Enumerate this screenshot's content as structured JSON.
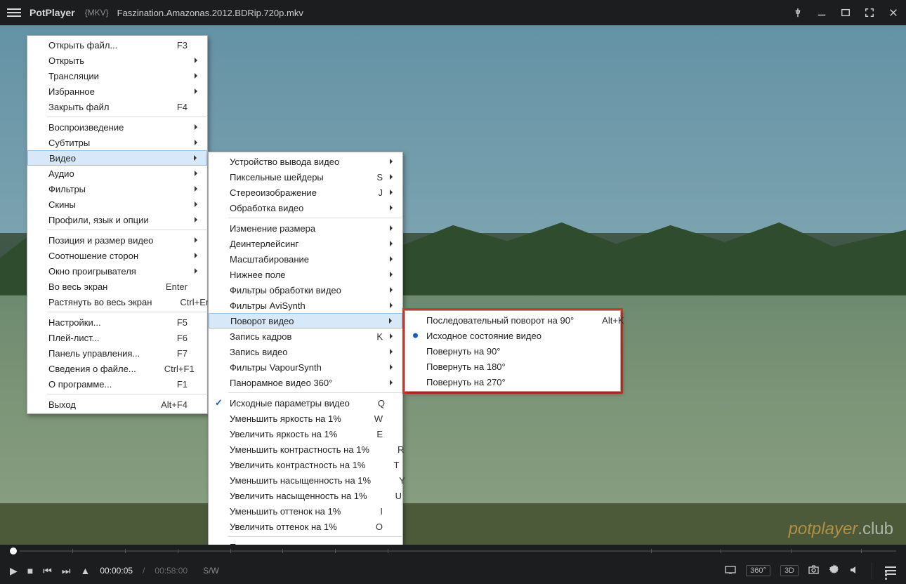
{
  "titlebar": {
    "app": "PotPlayer",
    "format": "{MKV}",
    "file": "Faszination.Amazonas.2012.BDRip.720p.mkv"
  },
  "watermark": {
    "main": "potplayer",
    "suffix": ".club"
  },
  "controls": {
    "current_time": "00:00:05",
    "total_time": "00:58:00",
    "hw": "S/W",
    "labels": {
      "360": "360°",
      "3d": "3D"
    }
  },
  "menu1": [
    {
      "t": "Открыть файл...",
      "sc": "F3"
    },
    {
      "t": "Открыть",
      "sub": true
    },
    {
      "t": "Трансляции",
      "sub": true
    },
    {
      "t": "Избранное",
      "sub": true
    },
    {
      "t": "Закрыть файл",
      "sc": "F4"
    },
    {
      "sep": true
    },
    {
      "t": "Воспроизведение",
      "sub": true
    },
    {
      "t": "Субтитры",
      "sub": true
    },
    {
      "t": "Видео",
      "sub": true,
      "hl": true
    },
    {
      "t": "Аудио",
      "sub": true
    },
    {
      "t": "Фильтры",
      "sub": true
    },
    {
      "t": "Скины",
      "sub": true
    },
    {
      "t": "Профили, язык и опции",
      "sub": true
    },
    {
      "sep": true
    },
    {
      "t": "Позиция и размер видео",
      "sub": true
    },
    {
      "t": "Соотношение сторон",
      "sub": true
    },
    {
      "t": "Окно проигрывателя",
      "sub": true
    },
    {
      "t": "Во весь экран",
      "sc": "Enter"
    },
    {
      "t": "Растянуть во весь экран",
      "sc": "Ctrl+Enter"
    },
    {
      "sep": true
    },
    {
      "t": "Настройки...",
      "sc": "F5"
    },
    {
      "t": "Плей-лист...",
      "sc": "F6"
    },
    {
      "t": "Панель управления...",
      "sc": "F7"
    },
    {
      "t": "Сведения о файле...",
      "sc": "Ctrl+F1"
    },
    {
      "t": "О программе...",
      "sc": "F1"
    },
    {
      "sep": true
    },
    {
      "t": "Выход",
      "sc": "Alt+F4"
    }
  ],
  "menu2": [
    {
      "t": "Устройство вывода видео",
      "sub": true
    },
    {
      "t": "Пиксельные шейдеры",
      "sc": "S",
      "sub": true
    },
    {
      "t": "Стереоизображение",
      "sc": "J",
      "sub": true
    },
    {
      "t": "Обработка видео",
      "sub": true
    },
    {
      "sep": true
    },
    {
      "t": "Изменение размера",
      "sub": true
    },
    {
      "t": "Деинтерлейсинг",
      "sub": true
    },
    {
      "t": "Масштабирование",
      "sub": true
    },
    {
      "t": "Нижнее поле",
      "sub": true
    },
    {
      "t": "Фильтры обработки видео",
      "sub": true
    },
    {
      "t": "Фильтры AviSynth",
      "sub": true
    },
    {
      "t": "Поворот видео",
      "sub": true,
      "hl": true
    },
    {
      "t": "Запись кадров",
      "sc": "K",
      "sub": true
    },
    {
      "t": "Запись видео",
      "sub": true
    },
    {
      "t": "Фильтры VapourSynth",
      "sub": true
    },
    {
      "t": "Панорамное видео 360°",
      "sub": true
    },
    {
      "sep": true
    },
    {
      "t": "Исходные параметры видео",
      "sc": "Q",
      "chk": true
    },
    {
      "t": "Уменьшить яркость на 1%",
      "sc": "W"
    },
    {
      "t": "Увеличить яркость на 1%",
      "sc": "E"
    },
    {
      "t": "Уменьшить контрастность на 1%",
      "sc": "R"
    },
    {
      "t": "Увеличить контрастность на 1%",
      "sc": "T"
    },
    {
      "t": "Уменьшить насыщенность на 1%",
      "sc": "Y"
    },
    {
      "t": "Увеличить насыщенность на 1%",
      "sc": "U"
    },
    {
      "t": "Уменьшить оттенок на 1%",
      "sc": "I"
    },
    {
      "t": "Увеличить оттенок на 1%",
      "sc": "O"
    },
    {
      "sep": true
    },
    {
      "t": "Параметры вывода видео..."
    }
  ],
  "menu3": [
    {
      "t": "Последовательный поворот на 90°",
      "sc": "Alt+K"
    },
    {
      "t": "Исходное состояние видео",
      "radio": true
    },
    {
      "t": "Повернуть на 90°"
    },
    {
      "t": "Повернуть на 180°"
    },
    {
      "t": "Повернуть на 270°"
    }
  ]
}
